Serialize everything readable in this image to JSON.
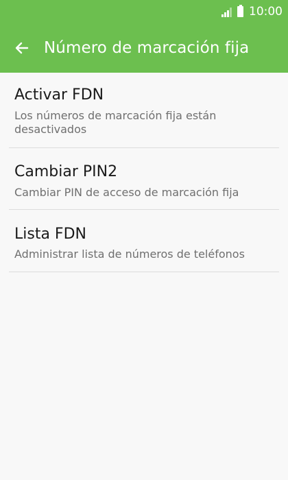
{
  "status_bar": {
    "time": "10:00",
    "icons": [
      "signal-icon",
      "battery-icon"
    ]
  },
  "app_bar": {
    "back_icon": "arrow-left-icon",
    "title": "Número de marcación fija"
  },
  "colors": {
    "accent": "#6cbf4f",
    "background": "#f8f8f8",
    "title_text": "#1a1a1a",
    "subtitle_text": "#6f6f6f",
    "divider": "#dcdcdc"
  },
  "settings": [
    {
      "title": "Activar FDN",
      "subtitle_line1": "Los números de marcación fija están",
      "subtitle_line2": "desactivados"
    },
    {
      "title": "Cambiar PIN2",
      "subtitle": "Cambiar PIN de acceso de marcación fija"
    },
    {
      "title": "Lista FDN",
      "subtitle": "Administrar lista de números de teléfonos"
    }
  ]
}
